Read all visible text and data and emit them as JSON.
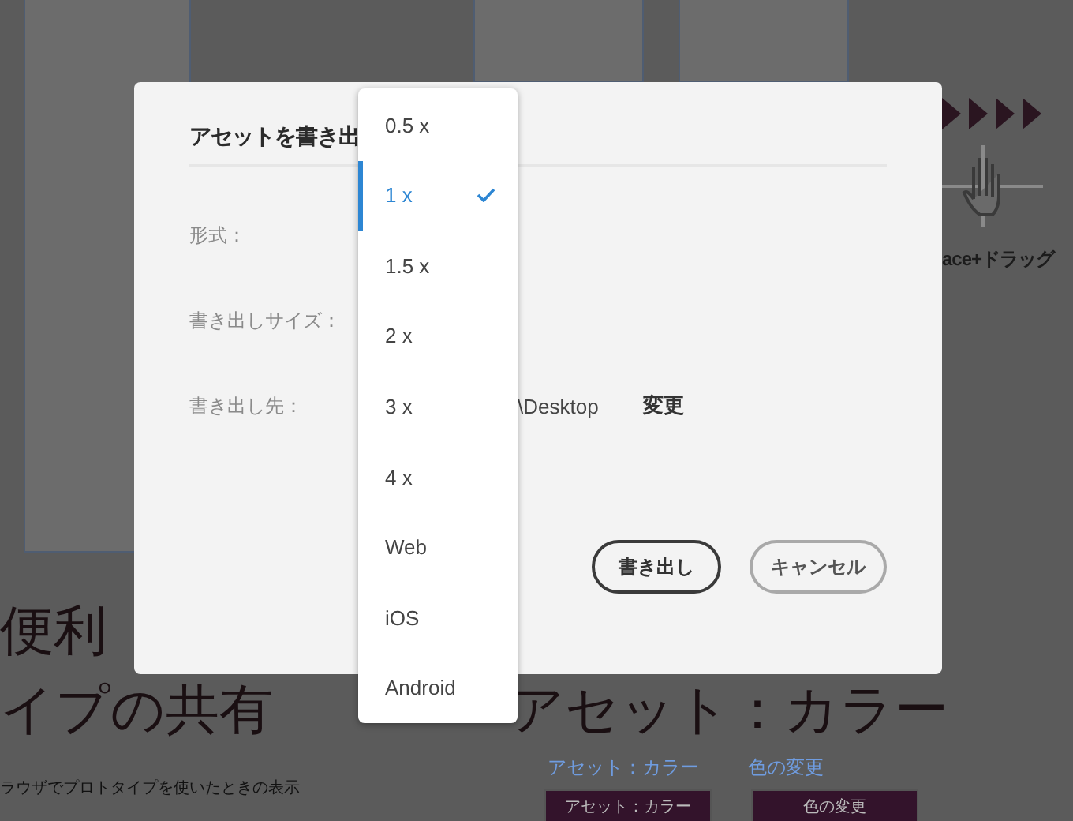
{
  "canvas": {
    "hint_label": "ace+ドラッグ",
    "headings": [
      {
        "text": "便利"
      },
      {
        "text": "イプの共有"
      },
      {
        "text": "アセット：カラー"
      }
    ],
    "caption": "ラウザでプロトタイプを使いたときの表示",
    "panels": [
      {
        "title": "アセット：カラー",
        "bar_title": "アセット：カラー"
      },
      {
        "title": "色の変更",
        "bar_title": "色の変更"
      }
    ]
  },
  "dialog": {
    "title": "アセットを書き出",
    "fields": [
      {
        "label": "形式："
      },
      {
        "label": "書き出しサイズ："
      },
      {
        "label": "書き出し先：",
        "value": "\\Desktop",
        "action": "変更"
      }
    ],
    "buttons": [
      {
        "label": "書き出し",
        "kind": "primary"
      },
      {
        "label": "キャンセル",
        "kind": "secondary"
      }
    ]
  },
  "dropdown": {
    "options": [
      {
        "label": "0.5 x",
        "selected": false
      },
      {
        "label": "1 x",
        "selected": true
      },
      {
        "label": "1.5 x",
        "selected": false
      },
      {
        "label": "2 x",
        "selected": false
      },
      {
        "label": "3 x",
        "selected": false
      },
      {
        "label": "4 x",
        "selected": false
      },
      {
        "label": "Web",
        "selected": false
      },
      {
        "label": "iOS",
        "selected": false
      },
      {
        "label": "Android",
        "selected": false
      }
    ]
  }
}
